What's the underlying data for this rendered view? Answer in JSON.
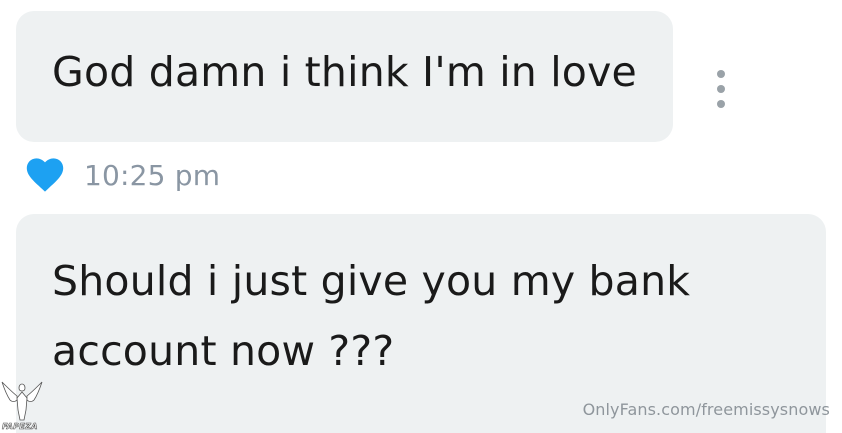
{
  "messages": [
    {
      "text": "God damn i think I'm in love"
    },
    {
      "lines": [
        "Should i just give you my bank",
        "account now ???"
      ]
    }
  ],
  "meta": {
    "timestamp": "10:25 pm",
    "heart_icon": "heart-icon",
    "heart_color": "#1DA1F2",
    "more_icon": "more-vertical-icon"
  },
  "watermark": {
    "text": "OnlyFans.com/freemissysnows",
    "logo_text": "FAPEZA"
  },
  "colors": {
    "bubble_bg": "#eef1f2",
    "timestamp": "#8a96a3",
    "dots": "#9aa2a8"
  }
}
